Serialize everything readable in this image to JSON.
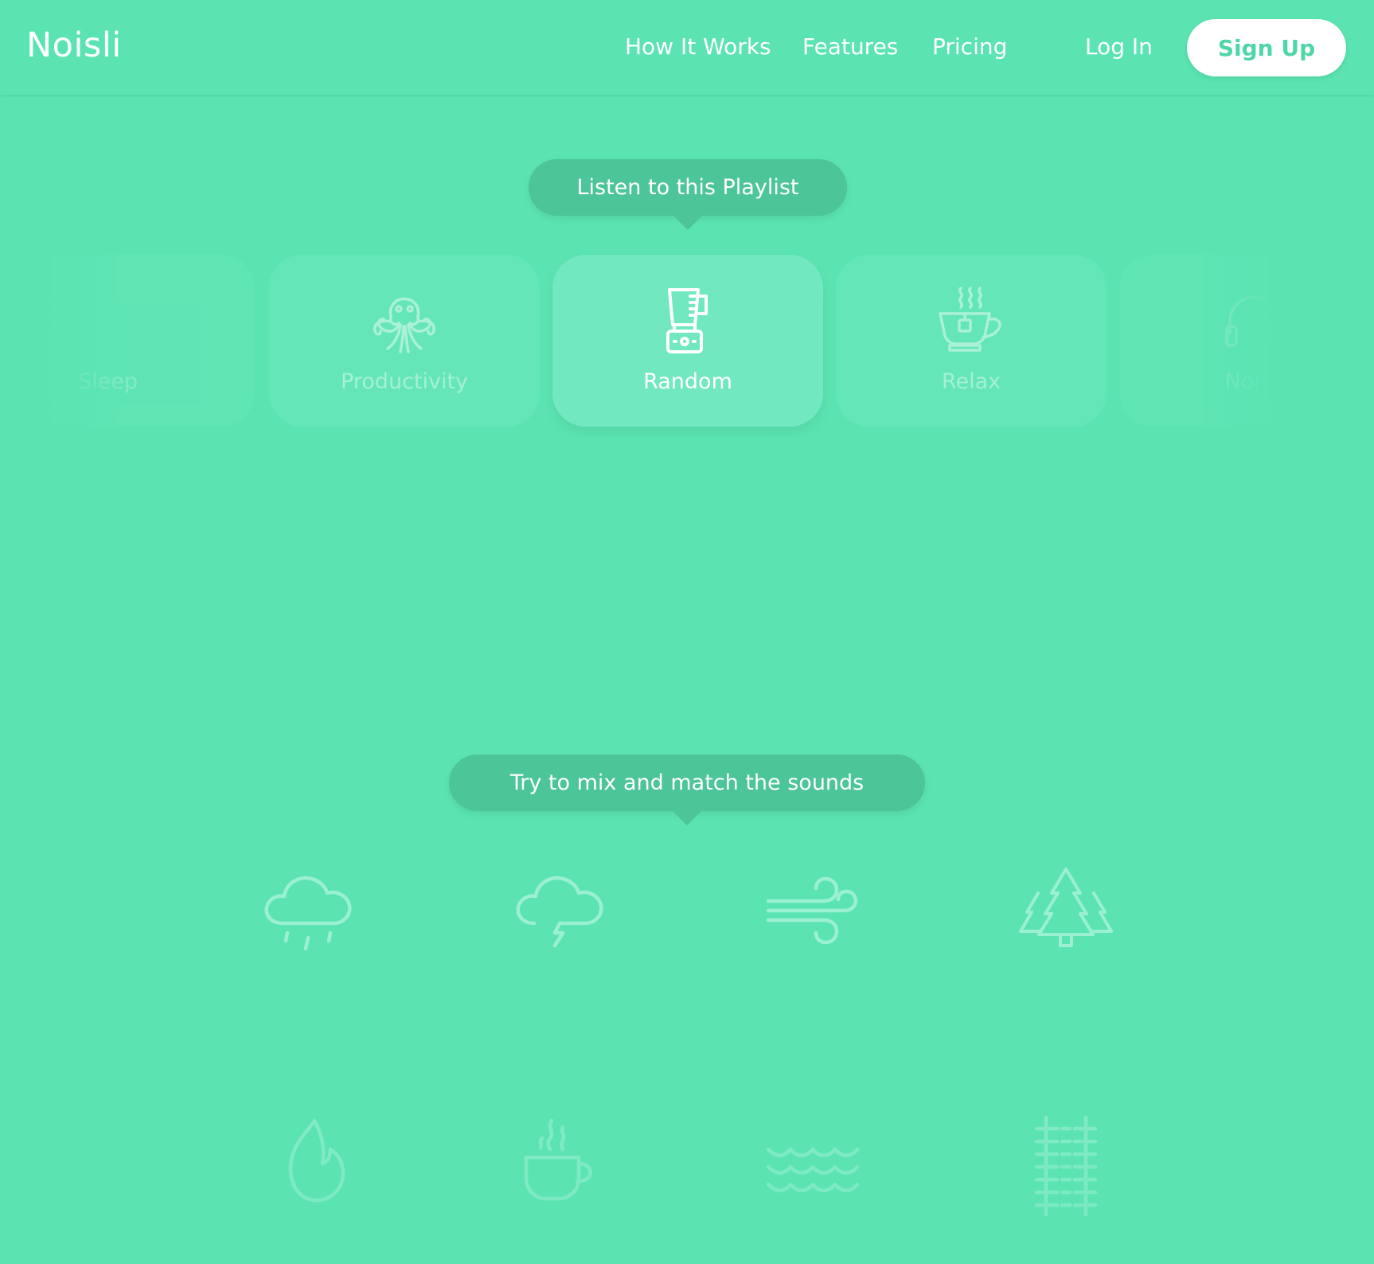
{
  "header": {
    "logo": "Noisli",
    "nav": [
      "How It Works",
      "Features",
      "Pricing"
    ],
    "login": "Log In",
    "signup": "Sign Up"
  },
  "playlist": {
    "prompt": "Listen to this Playlist",
    "cards": [
      {
        "label": "Sleep",
        "icon": "sleep-zzz-icon"
      },
      {
        "label": "Productivity",
        "icon": "octopus-icon"
      },
      {
        "label": "Random",
        "icon": "blender-icon",
        "active": true
      },
      {
        "label": "Relax",
        "icon": "tea-cup-icon"
      },
      {
        "label": "Noise",
        "icon": "headphones-icon"
      }
    ]
  },
  "sounds": {
    "prompt": "Try to mix and match the sounds",
    "items": [
      "rain-icon",
      "thunderstorm-icon",
      "wind-icon",
      "forest-icon",
      "fire-icon",
      "coffee-icon",
      "waves-icon",
      "train-track-icon"
    ]
  },
  "colors": {
    "background": "#5be4b2",
    "bubble": "#4cc598",
    "card": "#64e6b8",
    "card_active": "#71e8c0",
    "signup_text": "#4fd6a6"
  }
}
